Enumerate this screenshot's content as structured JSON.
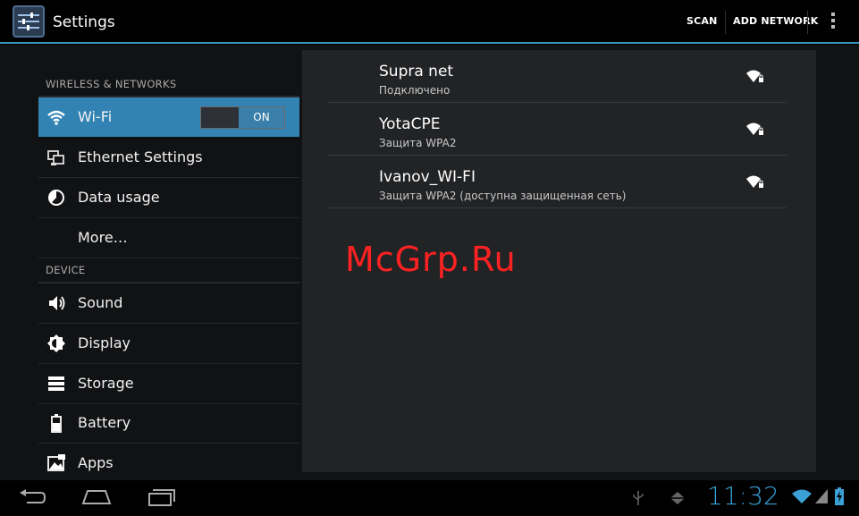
{
  "actionbar": {
    "title": "Settings",
    "scan": "SCAN",
    "add_network": "ADD NETWORK"
  },
  "sidebar": {
    "section_wireless": "WIRELESS & NETWORKS",
    "section_device": "DEVICE",
    "items": [
      {
        "label": "Wi-Fi",
        "icon": "wifi-icon"
      },
      {
        "label": "Ethernet Settings",
        "icon": "ethernet-icon"
      },
      {
        "label": "Data usage",
        "icon": "pie-chart-icon"
      },
      {
        "label": "More…",
        "icon": ""
      },
      {
        "label": "Sound",
        "icon": "speaker-icon"
      },
      {
        "label": "Display",
        "icon": "brightness-icon"
      },
      {
        "label": "Storage",
        "icon": "storage-icon"
      },
      {
        "label": "Battery",
        "icon": "battery-icon"
      },
      {
        "label": "Apps",
        "icon": "apps-icon"
      }
    ],
    "wifi_toggle": {
      "state": "ON"
    }
  },
  "networks": [
    {
      "ssid": "Supra net",
      "status": "Подключено"
    },
    {
      "ssid": "YotaCPE",
      "status": "Защита WPA2"
    },
    {
      "ssid": "Ivanov_WI-FI",
      "status": "Защита WPA2 (доступна защищенная сеть)"
    }
  ],
  "watermark": "McGrp.Ru",
  "statusbar": {
    "time": "11:32"
  },
  "colors": {
    "accent": "#3283b3",
    "clock": "#3aa0d6",
    "watermark": "#ff2222"
  }
}
